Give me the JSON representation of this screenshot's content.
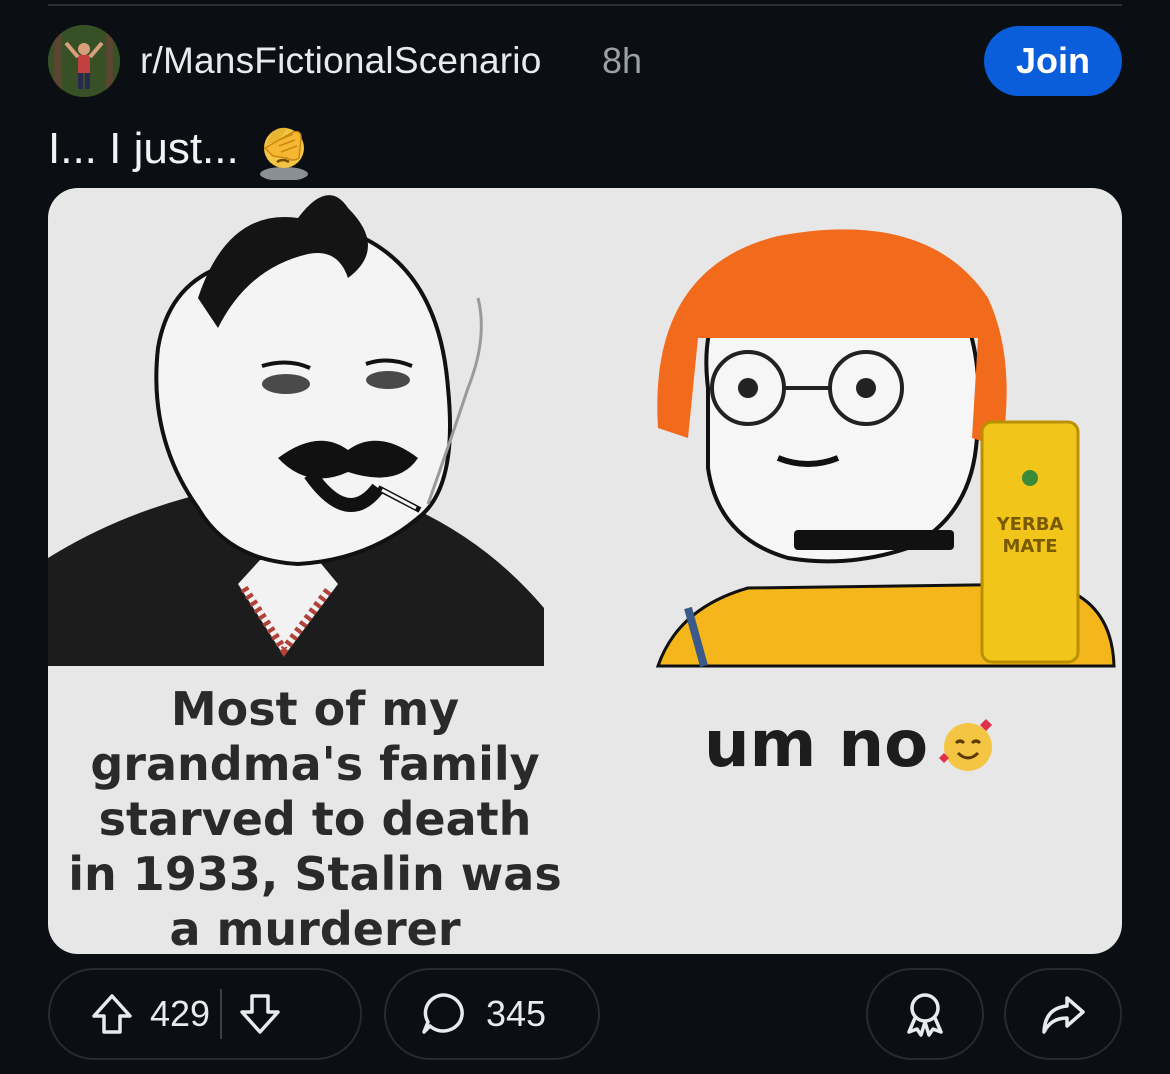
{
  "post": {
    "subreddit": "r/MansFictionalScenario",
    "time": "8h",
    "join_label": "Join",
    "title": "I... I just...",
    "title_emoji": "face-palm-emoji"
  },
  "meme": {
    "left_caption": "Most of my\ngrandma's family\nstarved to death\nin 1933, Stalin was\na murderer",
    "right_caption": "um no",
    "right_emoji": "smiling-face-with-hearts-emoji",
    "can_label_line1": "YERBA",
    "can_label_line2": "MATE"
  },
  "actions": {
    "upvotes": "429",
    "comments": "345",
    "upvote_icon": "arrow-up-icon",
    "downvote_icon": "arrow-down-icon",
    "comment_icon": "speech-bubble-icon",
    "award_icon": "award-icon",
    "share_icon": "share-icon"
  },
  "colors": {
    "background": "#0b0e12",
    "join_button": "#0a5ddb",
    "meme_background": "#e7e7e7",
    "hair_orange": "#f26a1b",
    "shirt_yellow": "#f4b61a"
  }
}
